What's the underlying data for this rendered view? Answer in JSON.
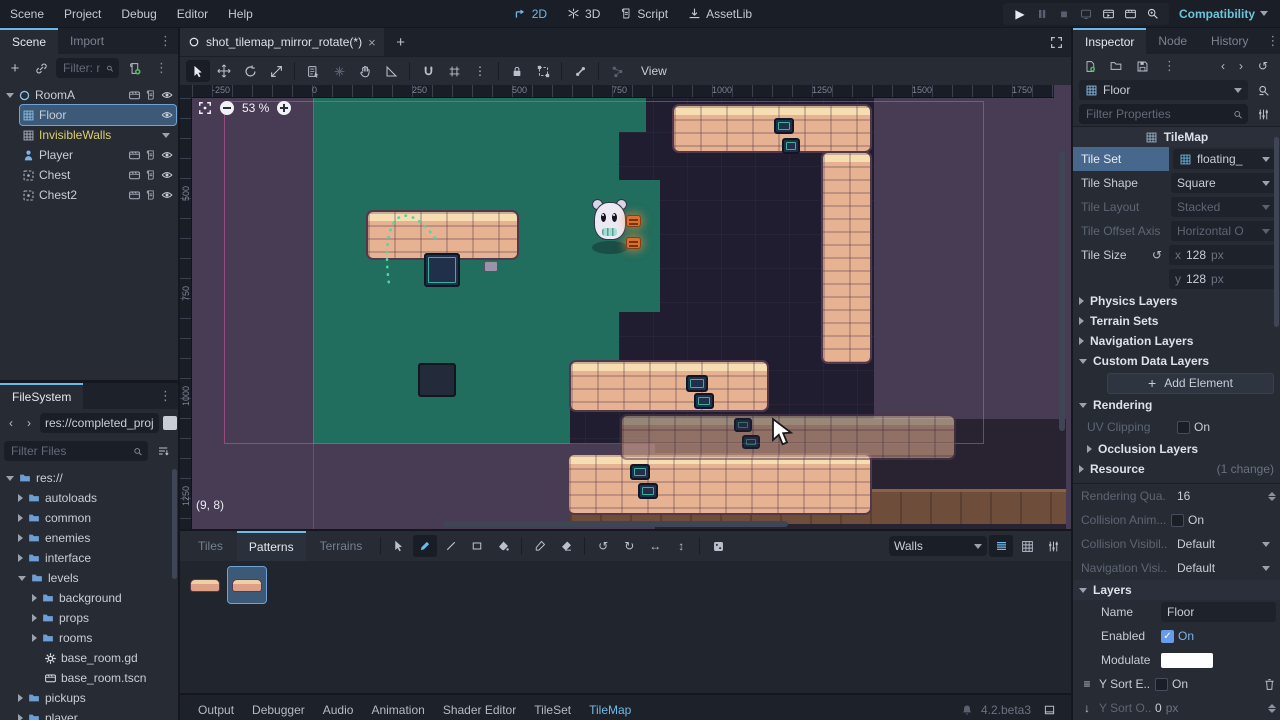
{
  "menubar": {
    "items": [
      "Scene",
      "Project",
      "Debug",
      "Editor",
      "Help"
    ],
    "contexts": [
      {
        "label": "2D",
        "active": true
      },
      {
        "label": "3D",
        "active": false
      },
      {
        "label": "Script",
        "active": false
      },
      {
        "label": "AssetLib",
        "active": false
      }
    ],
    "playback_icons": [
      "play",
      "pause",
      "stop",
      "remote-debug",
      "play-scene",
      "play-custom-scene",
      "profiler"
    ],
    "renderer": "Compatibility"
  },
  "scene_dock": {
    "tabs": [
      "Scene",
      "Import"
    ],
    "filter_placeholder": "Filter: na",
    "nodes": [
      {
        "name": "RoomA"
      },
      {
        "name": "Floor"
      },
      {
        "name": "InvisibleWalls"
      },
      {
        "name": "Player"
      },
      {
        "name": "Chest"
      },
      {
        "name": "Chest2"
      }
    ]
  },
  "filesystem": {
    "title": "FileSystem",
    "path": "res://completed_proj",
    "filter_placeholder": "Filter Files",
    "items": [
      "res://",
      "autoloads",
      "common",
      "enemies",
      "interface",
      "levels",
      "background",
      "props",
      "rooms",
      "base_room.gd",
      "base_room.tscn",
      "pickups",
      "player"
    ]
  },
  "viewport": {
    "scene_tab": "shot_tilemap_mirror_rotate(*)",
    "view_menu": "View",
    "zoom_level": "53 %",
    "cell_coords": "(9, 8)",
    "ruler_x": [
      "-250",
      "0",
      "250",
      "500",
      "750",
      "1000",
      "1250",
      "1500",
      "1750"
    ],
    "ruler_y": [
      "500",
      "750",
      "1000",
      "1250"
    ]
  },
  "tilemap_panel": {
    "tabs": [
      "Tiles",
      "Patterns",
      "Terrains"
    ],
    "active_tab": "Patterns",
    "layer_dropdown": "Walls"
  },
  "statusbar": {
    "tabs": [
      "Output",
      "Debugger",
      "Audio",
      "Animation",
      "Shader Editor",
      "TileSet",
      "TileMap"
    ],
    "active": "TileMap",
    "version": "4.2.beta3"
  },
  "inspector": {
    "tabs": [
      "Inspector",
      "Node",
      "History"
    ],
    "node_name": "Floor",
    "filter_placeholder": "Filter Properties",
    "section_title": "TileMap",
    "tile_set": {
      "label": "Tile Set",
      "value": "floating_"
    },
    "tile_shape": {
      "label": "Tile Shape",
      "value": "Square"
    },
    "tile_layout": {
      "label": "Tile Layout",
      "value": "Stacked"
    },
    "tile_offset_axis": {
      "label": "Tile Offset Axis",
      "value": "Horizontal O"
    },
    "tile_size": {
      "label": "Tile Size",
      "x_label": "x",
      "x_value": "128",
      "y_label": "y",
      "y_value": "128",
      "unit": "px"
    },
    "groups": {
      "physics": "Physics Layers",
      "terrain": "Terrain Sets",
      "navigation": "Navigation Layers",
      "custom_data": "Custom Data Layers",
      "rendering": "Rendering",
      "occlusion": "Occlusion Layers",
      "resource": "Resource",
      "layers": "Layers"
    },
    "add_element_label": "Add Element",
    "uv_clipping": {
      "label": "UV Clipping",
      "value": "On"
    },
    "resource_badge": "(1 change)",
    "quadrant": {
      "label": "Rendering Qua...",
      "value": "16"
    },
    "collision_anim": {
      "label": "Collision Anim...",
      "value": "On"
    },
    "collision_vis": {
      "label": "Collision Visibil...",
      "value": "Default"
    },
    "nav_vis": {
      "label": "Navigation Visi...",
      "value": "Default"
    },
    "layer_props": {
      "name": {
        "label": "Name",
        "value": "Floor"
      },
      "enabled": {
        "label": "Enabled",
        "value": "On"
      },
      "modulate": {
        "label": "Modulate",
        "swatch": "#ffffff"
      },
      "ysort_enabled": {
        "label": "Y Sort E...",
        "value": "On"
      },
      "ysort_origin": {
        "label": "Y Sort O...",
        "value": "0",
        "unit": "px"
      }
    }
  },
  "colors": {
    "accent_blue": "#6fb9e8",
    "selection_blue": "#3c5a78",
    "floor_teal": "#216d5e",
    "background_purple": "#473c54",
    "platform_pink": "#e7b292",
    "warning_yellow": "#ddcf6d",
    "renderer_teal": "#6cc5d8",
    "rune_orange": "#d8702e",
    "modulate_swatch": "#ffffff"
  }
}
